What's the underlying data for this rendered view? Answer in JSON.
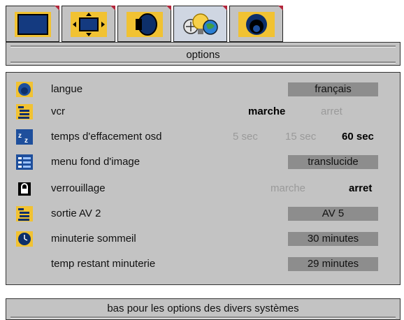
{
  "tabs": [
    {
      "icon": "screen-icon"
    },
    {
      "icon": "picture-size-icon"
    },
    {
      "icon": "speaker-icon"
    },
    {
      "icon": "options-bulb-icon"
    },
    {
      "icon": "globe-icon"
    }
  ],
  "header": {
    "title": "options"
  },
  "rows": [
    {
      "icon": "globe-icon",
      "label": "langue",
      "value": "français"
    },
    {
      "icon": "vcr-list-icon",
      "label": "vcr",
      "options": [
        "marche",
        "arret"
      ],
      "selected": "marche"
    },
    {
      "icon": "sleep-zz-icon",
      "label": "temps d'effacement osd",
      "options": [
        "5 sec",
        "15 sec",
        "60 sec"
      ],
      "selected": "60 sec"
    },
    {
      "icon": "menu-panel-icon",
      "label": "menu fond d'image",
      "value": "translucide"
    },
    {
      "icon": "lock-icon",
      "label": "verrouillage",
      "options": [
        "marche",
        "arret"
      ],
      "selected": "arret"
    },
    {
      "icon": "av-list-icon",
      "label": "sortie AV 2",
      "value": "AV 5"
    },
    {
      "icon": "clock-icon",
      "label": "minuterie sommeil",
      "value": "30  minutes"
    },
    {
      "icon": "",
      "label": "temp restant minuterie",
      "value": "29  minutes"
    }
  ],
  "footer": {
    "hint": "bas pour les  options des divers systèmes"
  },
  "colors": {
    "panel": "#c3c3c3",
    "value_box": "#8d8d8d",
    "icon_yellow": "#f1c232",
    "icon_blue": "#1e4f9c",
    "tab_corner": "#b3263b"
  }
}
